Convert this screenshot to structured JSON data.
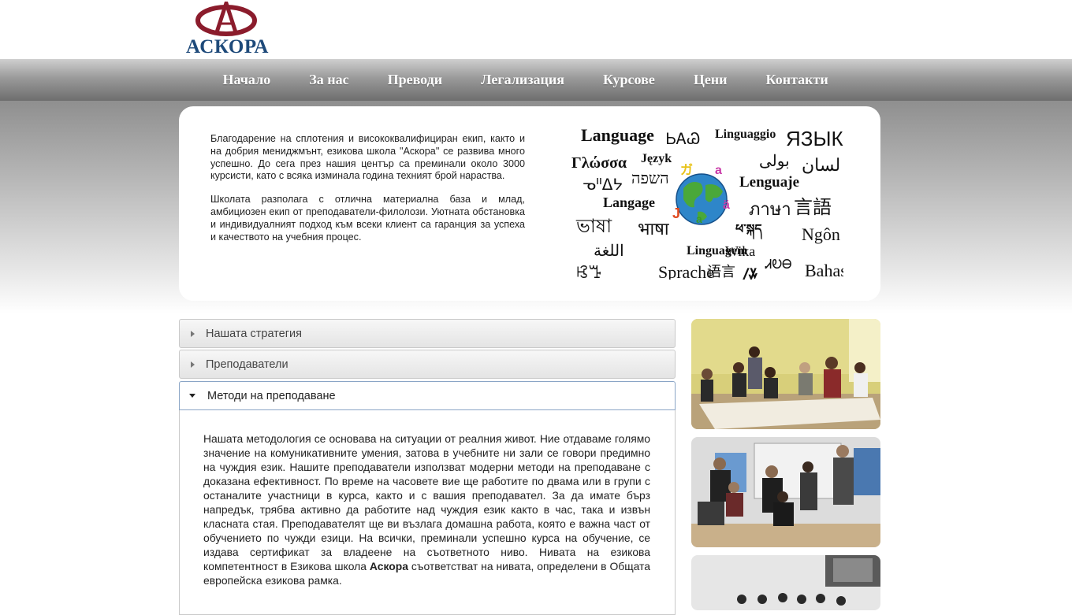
{
  "header": {
    "logo_text": "АСКОРА",
    "logo_icon": "askora-logo-icon"
  },
  "nav": {
    "items": [
      "Начало",
      "За нас",
      "Преводи",
      "Легализация",
      "Курсове",
      "Цени",
      "Контакти"
    ]
  },
  "intro": {
    "paragraph1": "Благодарение на сплотения и висококвалифициран екип, както и на добрия мениджмънт, езикова школа \"Аскора\" се развива много успешно. До сега през нашия център са преминали около 3000 курсисти, като с всяка изминала година техният брой нараства.",
    "paragraph2": "Школата разполага с отлична материална база и млад, амбициозен екип от преподаватели-филолози. Уютната обстановка и индивидуалният подход към всеки клиент са гаранция за успеха и качеството на учебния процес.",
    "language_words": [
      "Language",
      "ᏏᎪᏊ",
      "Linguaggio",
      "ЯЗЫК",
      "Γλώσσα",
      "Język",
      "بولی",
      "لسان",
      "ᓀᐦᐃᔭ",
      "השפה",
      "Lenguaje",
      "Langage",
      "ভাষা",
      "ภาษา",
      "言語",
      "भाषा",
      "ཕ་སྐད",
      "Ngôn ngữ",
      "اللغة",
      "Linguagem",
      "Wika",
      "ꕙꔤ",
      "Sprache",
      "语言",
      "ᏗᎧᎾ",
      "ꤷꤸ",
      "Bahasa",
      "언어"
    ]
  },
  "accordion": {
    "sections": [
      {
        "label": "Нашата стратегия",
        "open": false
      },
      {
        "label": "Преподаватели",
        "open": false
      },
      {
        "label": "Методи на преподаване",
        "open": true
      }
    ],
    "open_body_before": "Нашата методология се основава на ситуации от реалния живот. Ние отдаваме голямо значение на комуникативните умения, затова в учебните ни зали се говори предимно на чуждия език. Нашите преподаватели използват модерни методи на преподаване с доказана ефективност. По време на часовете вие ще работите по двама или в групи с останалите участници в курса, както и с вашия преподавател. За да имате бърз напредък, трябва активно да работите над чуждия език както в час, така и извън класната стая. Преподавателят ще ви възлага домашна работа, която е важна част от обучението по чужди езици. На всички, преминали успешно курса на обучение, се издава сертификат за владеене на съответното ниво. Нивата на езикова компетентност в Езикова школа ",
    "open_body_bold": "Аскора",
    "open_body_after": " съответстват на нивата, определени в Общата европейска езикова рамка."
  },
  "colors": {
    "logo_red": "#8b1c2c",
    "logo_blue": "#1e4a7a",
    "nav_text": "#ffffff",
    "accordion_open_border": "#8aa5c6"
  }
}
